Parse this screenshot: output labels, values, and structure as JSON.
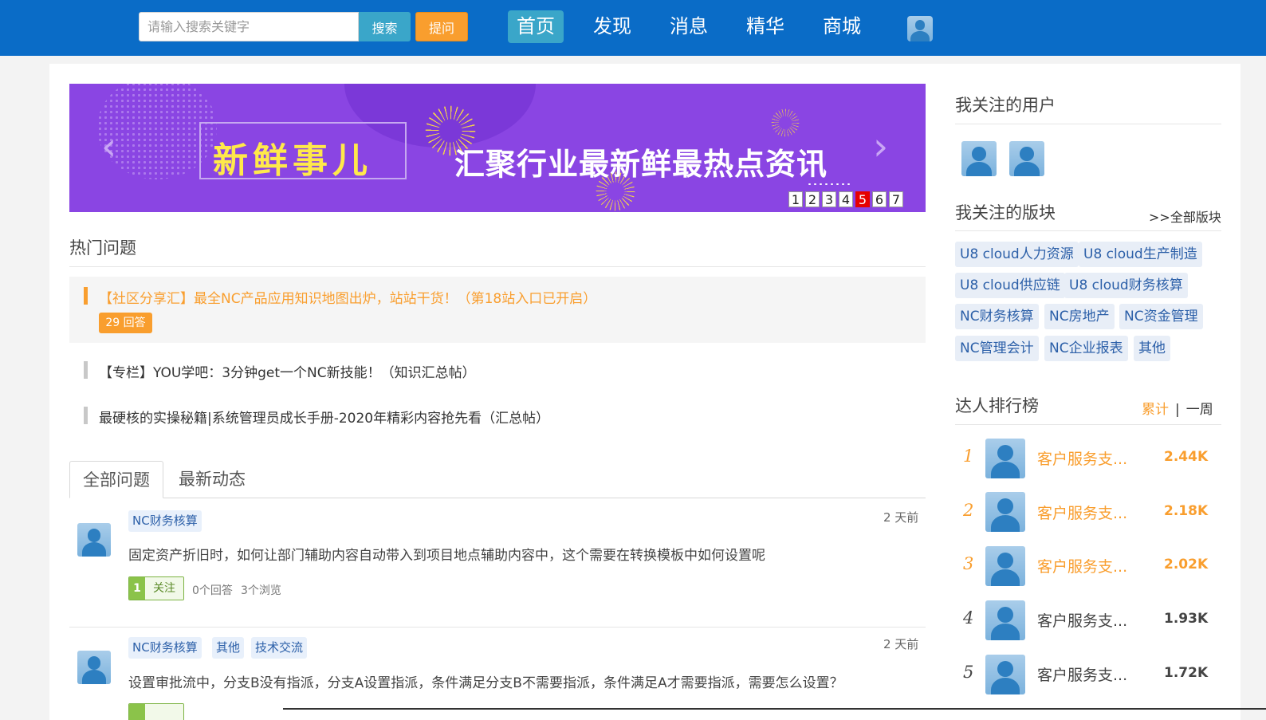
{
  "header": {
    "search_placeholder": "请输入搜索关键字",
    "search_label": "搜索",
    "ask_label": "提问",
    "nav": [
      "首页",
      "发现",
      "消息",
      "精华",
      "商城"
    ]
  },
  "banner": {
    "title": "新鲜事儿",
    "subtitle": "汇聚行业最新鲜最热点资讯",
    "pages": [
      "1",
      "2",
      "3",
      "4",
      "5",
      "6",
      "7"
    ],
    "active_page": "5",
    "prev": "‹",
    "next": "›"
  },
  "hot": {
    "title": "热门问题",
    "items": [
      {
        "text": "【社区分享汇】最全NC产品应用知识地图出炉，站站干货！（第18站入口已开启）",
        "answers": "29 回答"
      },
      {
        "text": "【专栏】YOU学吧：3分钟get一个NC新技能！（知识汇总帖）"
      },
      {
        "text": "最硬核的实操秘籍|系统管理员成长手册-2020年精彩内容抢先看（汇总帖）"
      }
    ]
  },
  "tabs": [
    "全部问题",
    "最新动态"
  ],
  "questions": [
    {
      "tags": [
        "NC财务核算"
      ],
      "time": "2 天前",
      "text": "固定资产折旧时，如何让部门辅助内容自动带入到项目地点辅助内容中，这个需要在转换模板中如何设置呢",
      "follow_count": "1",
      "follow_label": "关注",
      "answers": "0个回答",
      "views": "3个浏览"
    },
    {
      "tags": [
        "NC财务核算",
        "其他",
        "技术交流"
      ],
      "time": "2 天前",
      "text": "设置审批流中，分支B没有指派，分支A设置指派，条件满足分支B不需要指派，条件满足A才需要指派，需要怎么设置？"
    }
  ],
  "sidebar": {
    "followed_users_title": "我关注的用户",
    "boards_title": "我关注的版块",
    "all_boards": ">>全部版块",
    "boards": [
      "U8 cloud人力资源",
      "U8 cloud生产制造",
      "U8 cloud供应链",
      "U8 cloud财务核算",
      "NC财务核算",
      "NC房地产",
      "NC资金管理",
      "NC管理会计",
      "NC企业报表",
      "其他"
    ],
    "rank_title": "达人排行榜",
    "rank_total": "累计",
    "rank_sep": "|",
    "rank_week": "一周",
    "ranking": [
      {
        "rank": "1",
        "name": "客户服务支...",
        "score": "2.44K"
      },
      {
        "rank": "2",
        "name": "客户服务支...",
        "score": "2.18K"
      },
      {
        "rank": "3",
        "name": "客户服务支...",
        "score": "2.02K"
      },
      {
        "rank": "4",
        "name": "客户服务支...",
        "score": "1.93K"
      },
      {
        "rank": "5",
        "name": "客户服务支...",
        "score": "1.72K"
      }
    ]
  },
  "colors": {
    "header_bg": "#0a6cc7",
    "accent_orange": "#f99e2e",
    "nav_active": "#3aa6c9",
    "banner_bg": "#8a45e3"
  }
}
